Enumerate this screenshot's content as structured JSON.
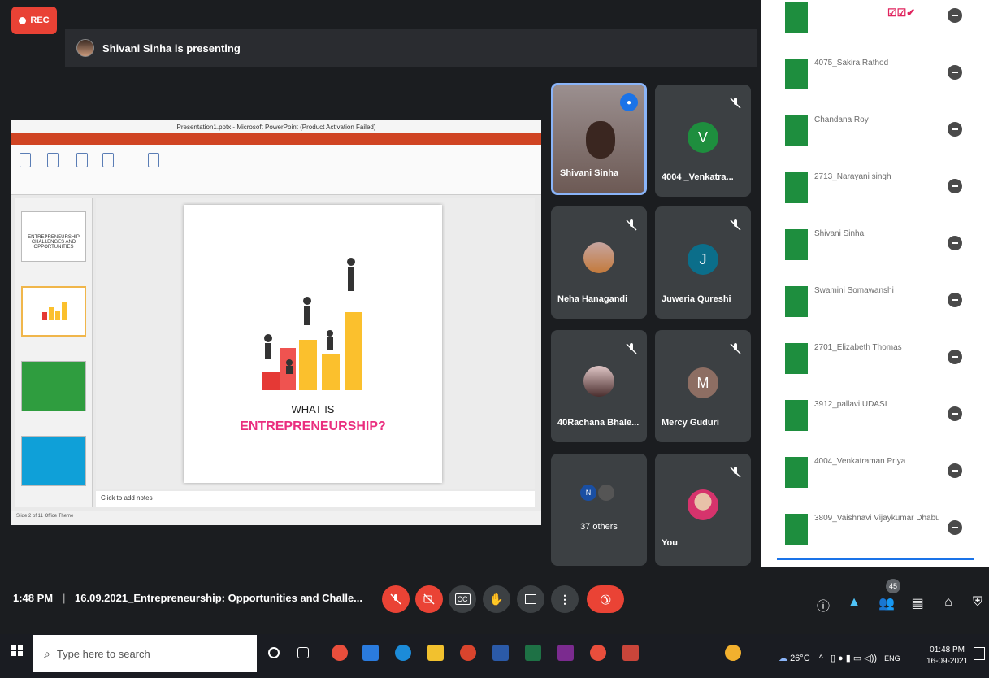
{
  "rec": {
    "label": "REC"
  },
  "presenting": {
    "text": "Shivani Sinha is presenting"
  },
  "shared_screen": {
    "window_title": "Presentation1.pptx - Microsoft PowerPoint (Product Activation Failed)",
    "thumbnails": [
      {
        "num": "1",
        "text": "ENTREPRENEURSHIP CHALLENGES AND OPPORTUNITIES"
      },
      {
        "num": "2",
        "text": ""
      },
      {
        "num": "3",
        "text": ""
      },
      {
        "num": "4",
        "text": ""
      }
    ],
    "slide": {
      "line1": "WHAT IS",
      "line2": "ENTREPRENEURSHIP?"
    },
    "notes": "Click to add notes",
    "status": "Slide 2 of 11   Office Theme"
  },
  "tiles": [
    {
      "name": "Shivani Sinha",
      "type": "photo",
      "active": true
    },
    {
      "name": "4004 _Venkatra...",
      "type": "letter",
      "letter": "V",
      "color": "#1e8e3e"
    },
    {
      "name": "Neha Hanagandi",
      "type": "photo"
    },
    {
      "name": "Juweria Qureshi",
      "type": "letter",
      "letter": "J",
      "color": "#0b6e8a"
    },
    {
      "name": "40Rachana Bhale...",
      "type": "photo"
    },
    {
      "name": "Mercy Guduri",
      "type": "letter",
      "letter": "M",
      "color": "#8d6e63"
    },
    {
      "name": "37 others",
      "type": "others"
    },
    {
      "name": "You",
      "type": "photo"
    }
  ],
  "participants": [
    {
      "name": "",
      "sub": ""
    },
    {
      "name": "4075_Sakira Rathod",
      "sub": ""
    },
    {
      "name": "Chandana Roy",
      "sub": ""
    },
    {
      "name": "2713_Narayani singh",
      "sub": ""
    },
    {
      "name": "Shivani Sinha",
      "sub": ""
    },
    {
      "name": "Swamini Somawanshi",
      "sub": ""
    },
    {
      "name": "2701_Elizabeth Thomas",
      "sub": ""
    },
    {
      "name": "3912_pallavi UDASI",
      "sub": ""
    },
    {
      "name": "4004_Venkatraman Priya",
      "sub": ""
    },
    {
      "name": "3809_Vaishnavi Vijaykumar Dhabu",
      "sub": ""
    }
  ],
  "meeting": {
    "time": "1:48 PM",
    "title": "16.09.2021_Entrepreneurship: Opportunities and Challe...",
    "people_count": "45"
  },
  "taskbar": {
    "search_placeholder": "Type here to search",
    "weather": "26°C",
    "lang": "ENG",
    "time": "01:48 PM",
    "date": "16-09-2021"
  }
}
